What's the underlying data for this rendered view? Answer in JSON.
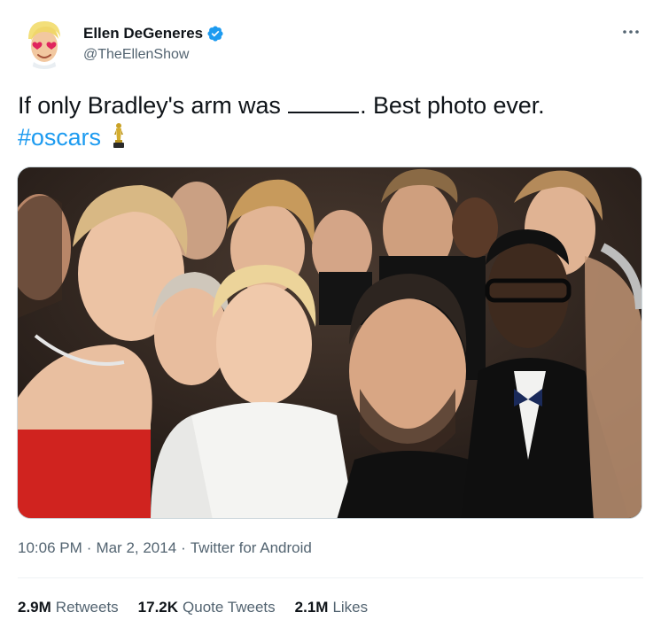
{
  "author": {
    "display_name": "Ellen DeGeneres",
    "handle": "@TheEllenShow",
    "verified": true
  },
  "tweet": {
    "text_before_blank": "If only Bradley's arm was",
    "text_after_blank": ". Best photo ever.",
    "hashtag": "#oscars",
    "emoji": "oscar-trophy-icon"
  },
  "meta": {
    "time": "10:06 PM",
    "date": "Mar 2, 2014",
    "source": "Twitter for Android",
    "separator": "·"
  },
  "stats": {
    "retweets_count": "2.9M",
    "retweets_label": "Retweets",
    "quotes_count": "17.2K",
    "quotes_label": "Quote Tweets",
    "likes_count": "2.1M",
    "likes_label": "Likes"
  },
  "colors": {
    "accent": "#1d9bf0",
    "text": "#0f1419",
    "secondary": "#536471",
    "divider": "#eff3f4"
  }
}
